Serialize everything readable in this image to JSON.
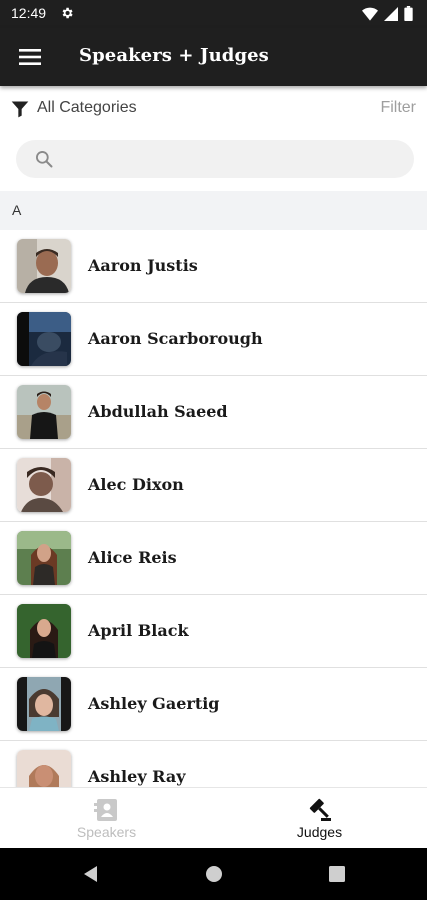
{
  "status_bar": {
    "time": "12:49",
    "icons": [
      "gear-icon",
      "wifi-icon",
      "signal-icon",
      "battery-icon"
    ]
  },
  "app_bar": {
    "title": "Speakers + Judges",
    "menu_icon": "hamburger-menu-icon"
  },
  "filter": {
    "categories_label": "All Categories",
    "filter_label": "Filter"
  },
  "search": {
    "placeholder": "",
    "value": ""
  },
  "section": {
    "letter": "A"
  },
  "speakers": [
    {
      "name": "Aaron Justis"
    },
    {
      "name": "Aaron Scarborough"
    },
    {
      "name": "Abdullah Saeed"
    },
    {
      "name": "Alec Dixon"
    },
    {
      "name": "Alice Reis"
    },
    {
      "name": "April Black"
    },
    {
      "name": "Ashley Gaertig"
    },
    {
      "name": "Ashley Ray"
    }
  ],
  "bottom_nav": {
    "tabs": [
      {
        "label": "Speakers",
        "icon": "contact-card-icon",
        "active": false
      },
      {
        "label": "Judges",
        "icon": "gavel-icon",
        "active": true
      }
    ]
  },
  "colors": {
    "app_bar": "#1f1f1f",
    "inactive_tab": "#bdbdbd",
    "active_tab": "#111111",
    "section_bg": "#f2f3f5",
    "search_bg": "#f1f1f1"
  }
}
